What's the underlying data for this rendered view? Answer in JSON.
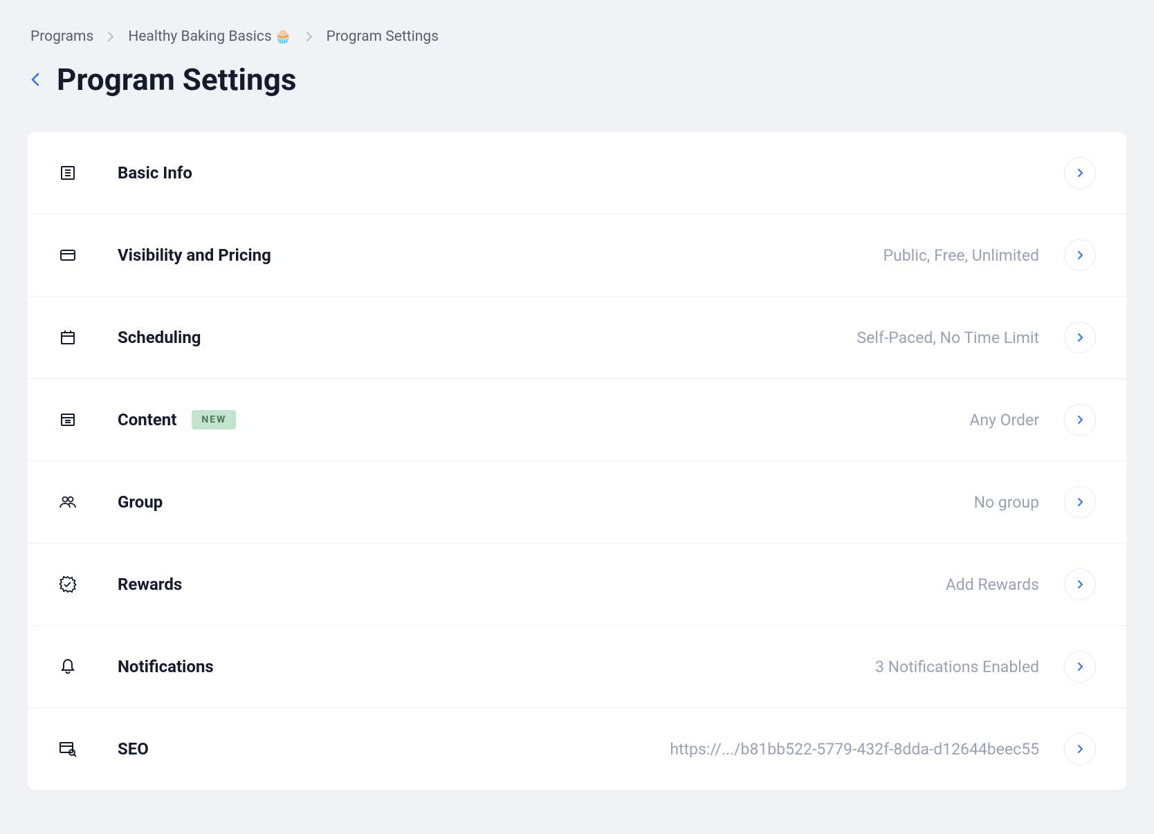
{
  "breadcrumb": {
    "items": [
      {
        "label": "Programs"
      },
      {
        "label": "Healthy Baking Basics",
        "emoji": "🧁"
      },
      {
        "label": "Program Settings"
      }
    ]
  },
  "page_title": "Program Settings",
  "settings": [
    {
      "icon": "document-icon",
      "label": "Basic Info",
      "value": "",
      "badge": ""
    },
    {
      "icon": "card-icon",
      "label": "Visibility and Pricing",
      "value": "Public, Free, Unlimited",
      "badge": ""
    },
    {
      "icon": "calendar-icon",
      "label": "Scheduling",
      "value": "Self-Paced, No Time Limit",
      "badge": ""
    },
    {
      "icon": "content-icon",
      "label": "Content",
      "value": "Any Order",
      "badge": "NEW"
    },
    {
      "icon": "group-icon",
      "label": "Group",
      "value": "No group",
      "badge": ""
    },
    {
      "icon": "rewards-icon",
      "label": "Rewards",
      "value": "Add Rewards",
      "badge": ""
    },
    {
      "icon": "bell-icon",
      "label": "Notifications",
      "value": "3 Notifications Enabled",
      "badge": ""
    },
    {
      "icon": "seo-icon",
      "label": "SEO",
      "value": "https://.../b81bb522-5779-432f-8dda-d12644beec55",
      "badge": ""
    }
  ]
}
